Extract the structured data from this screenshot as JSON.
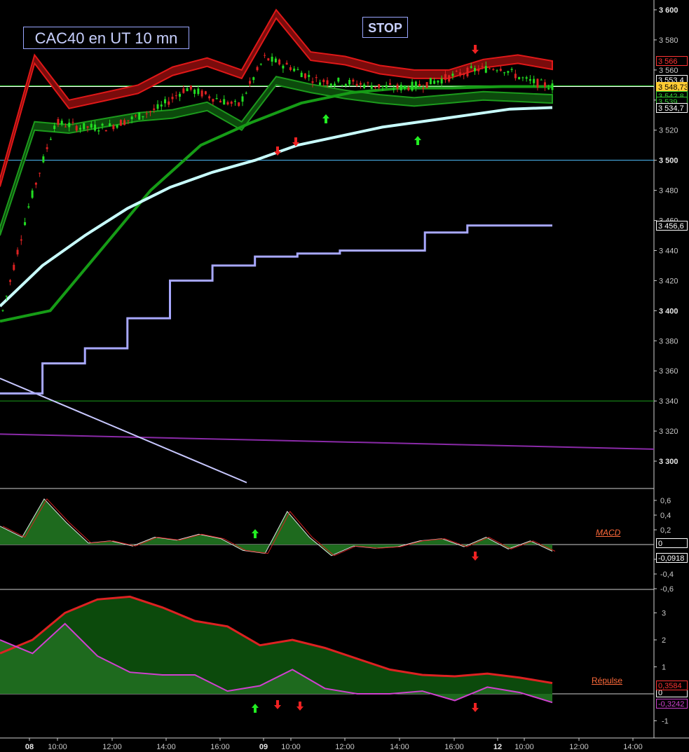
{
  "title": "CAC40 en UT 10 mn",
  "stop_label": "STOP",
  "colors": {
    "background": "#000000",
    "bull_candle": "#22dd22",
    "bear_candle": "#dd2222",
    "resistance_band": "#e01818",
    "support_band": "#1c9a1c",
    "ma_long": "#c8ffff",
    "ma_green": "#169c16",
    "step_line": "#a8a8ff",
    "hline_blue": "#4fc0ff",
    "hline_green": "#1aa01a",
    "hline_purple": "#8a2aa8",
    "macd_fill_pos": "#1e6a1e",
    "macd_fill_neg": "#6a1414",
    "arrow_up": "#22ee22",
    "arrow_down": "#ee2222"
  },
  "main_axis": {
    "ticks": [
      {
        "label": "3 600",
        "value": 3600,
        "bold": true
      },
      {
        "label": "3 580",
        "value": 3580
      },
      {
        "label": "3 560",
        "value": 3560
      },
      {
        "label": "3 540",
        "value": 3540
      },
      {
        "label": "3 520",
        "value": 3520
      },
      {
        "label": "3 500",
        "value": 3500,
        "bold": true
      },
      {
        "label": "3 480",
        "value": 3480
      },
      {
        "label": "3 460",
        "value": 3460
      },
      {
        "label": "3 440",
        "value": 3440
      },
      {
        "label": "3 420",
        "value": 3420
      },
      {
        "label": "3 400",
        "value": 3400,
        "bold": true
      },
      {
        "label": "3 380",
        "value": 3380
      },
      {
        "label": "3 360",
        "value": 3360
      },
      {
        "label": "3 340",
        "value": 3340
      },
      {
        "label": "3 320",
        "value": 3320
      },
      {
        "label": "3 300",
        "value": 3300,
        "bold": true
      }
    ],
    "price_tags": [
      {
        "label": "3 566",
        "value": 3566,
        "color": "#ff3333",
        "bg": "#000000"
      },
      {
        "label": "3 553,4",
        "value": 3553.4,
        "color": "#ffffff",
        "bg": "#000000"
      },
      {
        "label": "3 548,73",
        "value": 3548.73,
        "color": "#000000",
        "bg": "#ffcc33"
      },
      {
        "label": "3 542,8",
        "value": 3542.8,
        "color": "#33cc33",
        "bg": "#000000"
      },
      {
        "label": "3 539",
        "value": 3539,
        "color": "#33cc33",
        "bg": "#000000"
      },
      {
        "label": "3 534,7",
        "value": 3534.7,
        "color": "#ffffff",
        "bg": "#000000"
      },
      {
        "label": "3 456,6",
        "value": 3456.6,
        "color": "#ffffff",
        "bg": "#000000"
      }
    ]
  },
  "x_axis": {
    "ticks": [
      {
        "label": "08",
        "bold": true
      },
      {
        "label": "10:00"
      },
      {
        "label": "12:00"
      },
      {
        "label": "14:00"
      },
      {
        "label": "16:00"
      },
      {
        "label": "09",
        "bold": true
      },
      {
        "label": "10:00"
      },
      {
        "label": "12:00"
      },
      {
        "label": "14:00"
      },
      {
        "label": "16:00"
      },
      {
        "label": "12",
        "bold": true
      },
      {
        "label": "10:00"
      },
      {
        "label": "12:00"
      },
      {
        "label": "14:00"
      }
    ]
  },
  "macd": {
    "label": "MACD",
    "value_tag": "-0,0918",
    "zero_tag": "0",
    "ticks": [
      {
        "label": "0,6",
        "value": 0.6
      },
      {
        "label": "0,4",
        "value": 0.4
      },
      {
        "label": "0,2",
        "value": 0.2
      },
      {
        "label": "-0,2",
        "value": -0.2
      },
      {
        "label": "-0,4",
        "value": -0.4
      },
      {
        "label": "-0,6",
        "value": -0.6
      }
    ]
  },
  "repulse": {
    "label": "Répulse",
    "value_tag_1": "0,3584",
    "value_tag_2": "-0,3242",
    "zero_tag": "0",
    "ticks": [
      {
        "label": "3",
        "value": 3
      },
      {
        "label": "2",
        "value": 2
      },
      {
        "label": "1",
        "value": 1
      },
      {
        "label": "-1",
        "value": -1
      }
    ]
  },
  "chart_data": {
    "type": "candlestick",
    "title": "CAC40 en UT 10 mn",
    "xlabel": "",
    "ylabel": "",
    "x": [
      "08",
      "10:00",
      "12:00",
      "14:00",
      "16:00",
      "09",
      "10:00",
      "12:00",
      "14:00",
      "16:00",
      "12",
      "10:00",
      "12:00",
      "14:00"
    ],
    "ylim": [
      3282,
      3606
    ],
    "price_points": [
      [
        "08 08:00",
        3400
      ],
      [
        "08 09:00",
        3470
      ],
      [
        "08 10:00",
        3525
      ],
      [
        "08 11:00",
        3522
      ],
      [
        "08 12:00",
        3522
      ],
      [
        "08 13:00",
        3528
      ],
      [
        "08 14:00",
        3535
      ],
      [
        "08 15:00",
        3548
      ],
      [
        "08 16:00",
        3542
      ],
      [
        "08 17:00",
        3536
      ],
      [
        "09 09:00",
        3568
      ],
      [
        "09 10:00",
        3562
      ],
      [
        "09 11:00",
        3553
      ],
      [
        "09 12:00",
        3552
      ],
      [
        "09 13:00",
        3550
      ],
      [
        "09 14:00",
        3548
      ],
      [
        "09 15:00",
        3550
      ],
      [
        "09 16:00",
        3555
      ],
      [
        "09 17:00",
        3560
      ],
      [
        "12 09:00",
        3562
      ],
      [
        "12 10:00",
        3553
      ],
      [
        "12 11:00",
        3549
      ]
    ],
    "resistance_upper": [
      3488,
      3570,
      3540,
      3545,
      3550,
      3562,
      3568,
      3560,
      3600,
      3572,
      3569,
      3563,
      3560,
      3560,
      3567,
      3570,
      3566
    ],
    "support_lower": [
      3450,
      3520,
      3518,
      3522,
      3526,
      3528,
      3533,
      3520,
      3550,
      3545,
      3541,
      3538,
      3536,
      3538,
      3540,
      3539,
      3538
    ],
    "ma_long": [
      3403,
      3430,
      3450,
      3468,
      3482,
      3492,
      3500,
      3510,
      3516,
      3522,
      3526,
      3530,
      3534,
      3535
    ],
    "ma_green": [
      3393,
      3400,
      3440,
      3480,
      3510,
      3525,
      3538,
      3545,
      3548,
      3548,
      3549,
      3549
    ],
    "step_line": [
      3345,
      3365,
      3375,
      3395,
      3420,
      3430,
      3436,
      3438,
      3440,
      3440,
      3452,
      3456.6,
      3456.6
    ],
    "horizontal_levels": [
      {
        "value": 3549,
        "color": "#ffffff"
      },
      {
        "value": 3549.5,
        "color": "#33cc33"
      },
      {
        "value": 3500,
        "color": "#4fc0ff"
      },
      {
        "value": 3340,
        "color": "#1aa01a"
      }
    ],
    "purple_line": [
      [
        0,
        3318
      ],
      [
        1,
        3308
      ]
    ],
    "down_trend_line": [
      [
        0,
        3355
      ],
      [
        1,
        3282
      ]
    ],
    "macd_ylim": [
      -0.7,
      0.7
    ],
    "macd_values": [
      0.25,
      0.1,
      0.62,
      0.3,
      0.02,
      0.05,
      -0.02,
      0.1,
      0.06,
      0.14,
      0.08,
      -0.08,
      -0.12,
      0.45,
      0.1,
      -0.15,
      -0.02,
      -0.05,
      -0.03,
      0.05,
      0.08,
      -0.03,
      0.1,
      -0.06,
      0.05,
      -0.09
    ],
    "repulse_ylim": [
      -1.4,
      3.7
    ],
    "repulse_upper": [
      1.5,
      2.0,
      3.0,
      3.5,
      3.6,
      3.2,
      2.7,
      2.5,
      1.8,
      2.0,
      1.7,
      1.3,
      0.9,
      0.7,
      0.65,
      0.75,
      0.6,
      0.4
    ],
    "repulse_lower": [
      2.0,
      1.5,
      2.6,
      1.4,
      0.8,
      0.7,
      0.7,
      0.1,
      0.3,
      0.9,
      0.2,
      0.0,
      0.0,
      0.1,
      -0.25,
      0.25,
      0.05,
      -0.32
    ]
  }
}
